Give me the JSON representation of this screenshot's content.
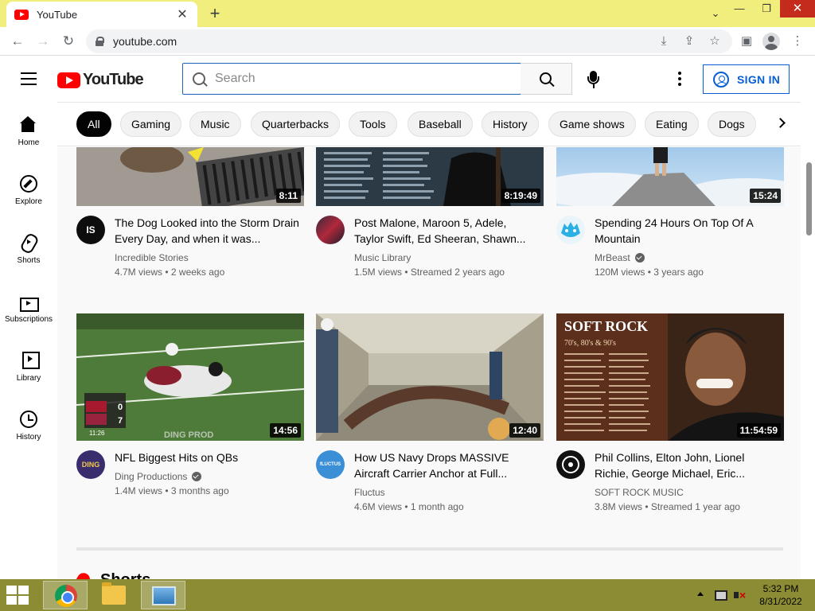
{
  "browser": {
    "tab_title": "YouTube",
    "tab_close": "✕",
    "new_tab": "+",
    "url": "youtube.com",
    "window_controls": {
      "chevron": "⌄",
      "minimize": "—",
      "maximize": "❐",
      "close": "✕"
    },
    "nav": {
      "back": "←",
      "forward": "→",
      "reload": "↻"
    }
  },
  "masthead": {
    "logo_text": "YouTube",
    "search_placeholder": "Search",
    "signin_label": "SIGN IN"
  },
  "sidebar": {
    "items": [
      {
        "label": "Home",
        "icon": "home-icon"
      },
      {
        "label": "Explore",
        "icon": "compass-icon"
      },
      {
        "label": "Shorts",
        "icon": "shorts-icon"
      },
      {
        "label": "Subscriptions",
        "icon": "subscriptions-icon"
      },
      {
        "label": "Library",
        "icon": "library-icon"
      },
      {
        "label": "History",
        "icon": "history-icon"
      }
    ]
  },
  "chips": [
    "All",
    "Gaming",
    "Music",
    "Quarterbacks",
    "Tools",
    "Baseball",
    "History",
    "Game shows",
    "Eating",
    "Dogs"
  ],
  "videos": [
    {
      "title": "The Dog Looked into the Storm Drain Every Day, and when it was...",
      "channel": "Incredible Stories",
      "verified": false,
      "views": "4.7M views",
      "age": "2 weeks ago",
      "duration": "8:11",
      "avatar_text": "IS"
    },
    {
      "title": "Post Malone, Maroon 5, Adele, Taylor Swift, Ed Sheeran, Shawn...",
      "channel": "Music Library",
      "verified": false,
      "views": "1.5M views",
      "age": "Streamed 2 years ago",
      "duration": "8:19:49",
      "avatar_text": ""
    },
    {
      "title": "Spending 24 Hours On Top Of A Mountain",
      "channel": "MrBeast",
      "verified": true,
      "views": "120M views",
      "age": "3 years ago",
      "duration": "15:24",
      "avatar_text": ""
    },
    {
      "title": "NFL Biggest Hits on QBs",
      "channel": "Ding Productions",
      "verified": true,
      "views": "1.4M views",
      "age": "3 months ago",
      "duration": "14:56",
      "avatar_text": "DING"
    },
    {
      "title": "How US Navy Drops MASSIVE Aircraft Carrier Anchor at Full...",
      "channel": "Fluctus",
      "verified": false,
      "views": "4.6M views",
      "age": "1 month ago",
      "duration": "12:40",
      "avatar_text": "fLUCTUS"
    },
    {
      "title": "Phil Collins, Elton John, Lionel Richie, George Michael, Eric...",
      "channel": "SOFT ROCK MUSIC",
      "verified": false,
      "views": "3.8M views",
      "age": "Streamed 1 year ago",
      "duration": "11:54:59",
      "avatar_text": ""
    }
  ],
  "thumb_text": {
    "ding_prod": "DING PROD",
    "soft_rock_title": "SOFT ROCK",
    "soft_rock_sub": "70's, 80's & 90's",
    "score_home": "0",
    "score_away": "7",
    "game_clock": "11:26"
  },
  "section": {
    "shorts_title": "Shorts"
  },
  "taskbar": {
    "time": "5:32 PM",
    "date": "8/31/2022"
  }
}
